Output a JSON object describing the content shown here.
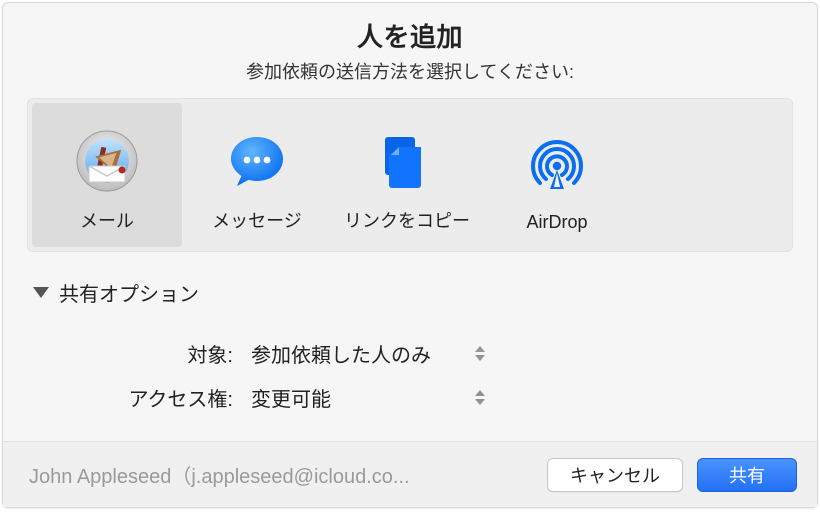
{
  "header": {
    "title": "人を追加",
    "subtitle": "参加依頼の送信方法を選択してください:"
  },
  "methods": [
    {
      "id": "mail",
      "label": "メール",
      "icon": "mail-app-icon",
      "selected": true
    },
    {
      "id": "messages",
      "label": "メッセージ",
      "icon": "messages-icon",
      "selected": false
    },
    {
      "id": "copylink",
      "label": "リンクをコピー",
      "icon": "copy-link-icon",
      "selected": false
    },
    {
      "id": "airdrop",
      "label": "AirDrop",
      "icon": "airdrop-icon",
      "selected": false
    }
  ],
  "options": {
    "disclosure_label": "共有オプション",
    "rows": {
      "who": {
        "label": "対象:",
        "value": "参加依頼した人のみ"
      },
      "permission": {
        "label": "アクセス権:",
        "value": "変更可能"
      }
    }
  },
  "footer": {
    "recipient": "John Appleseed（j.appleseed@icloud.co...",
    "cancel": "キャンセル",
    "share": "共有"
  },
  "colors": {
    "accent": "#2370f6"
  }
}
